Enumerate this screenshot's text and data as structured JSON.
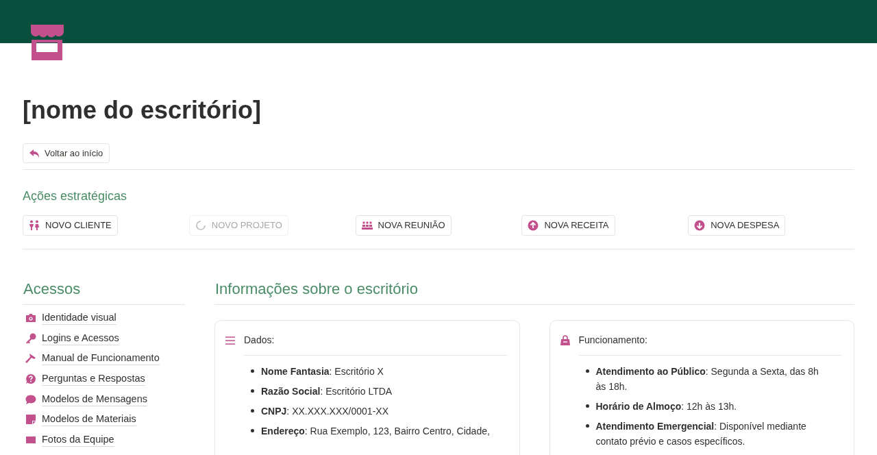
{
  "page": {
    "title": "[nome do escritório]"
  },
  "back_button": {
    "label": "Voltar ao início"
  },
  "actions": {
    "heading": "Ações estratégicas",
    "buttons": [
      {
        "label": "NOVO CLIENTE",
        "loading": false
      },
      {
        "label": "NOVO PROJETO",
        "loading": true
      },
      {
        "label": "NOVA REUNIÃO",
        "loading": false
      },
      {
        "label": "NOVA RECEITA",
        "loading": false
      },
      {
        "label": "NOVA DESPESA",
        "loading": false
      }
    ]
  },
  "accesses": {
    "heading": "Acessos",
    "items": [
      {
        "label": "Identidade visual"
      },
      {
        "label": "Logins e Acessos"
      },
      {
        "label": "Manual de Funcionamento"
      },
      {
        "label": "Perguntas e Respostas"
      },
      {
        "label": "Modelos de Mensagens"
      },
      {
        "label": "Modelos de Materiais"
      },
      {
        "label": "Fotos da Equipe"
      }
    ]
  },
  "info": {
    "heading": "Informações sobre o escritório",
    "cards": [
      {
        "title": "Dados:",
        "items": [
          "**Nome Fantasia**: Escritório X",
          "**Razão Social**: Escritório LTDA",
          "**CNPJ**: XX.XXX.XXX/0001-XX",
          "**Endereço**: Rua Exemplo, 123, Bairro Centro, Cidade,"
        ]
      },
      {
        "title": "Funcionamento:",
        "items": [
          "**Atendimento ao Público**: Segunda a Sexta, das 8h às 18h.",
          "**Horário de Almoço**: 12h às 13h.",
          "**Atendimento Emergencial**: Disponível mediante contato prévio e casos específicos."
        ]
      }
    ]
  }
}
